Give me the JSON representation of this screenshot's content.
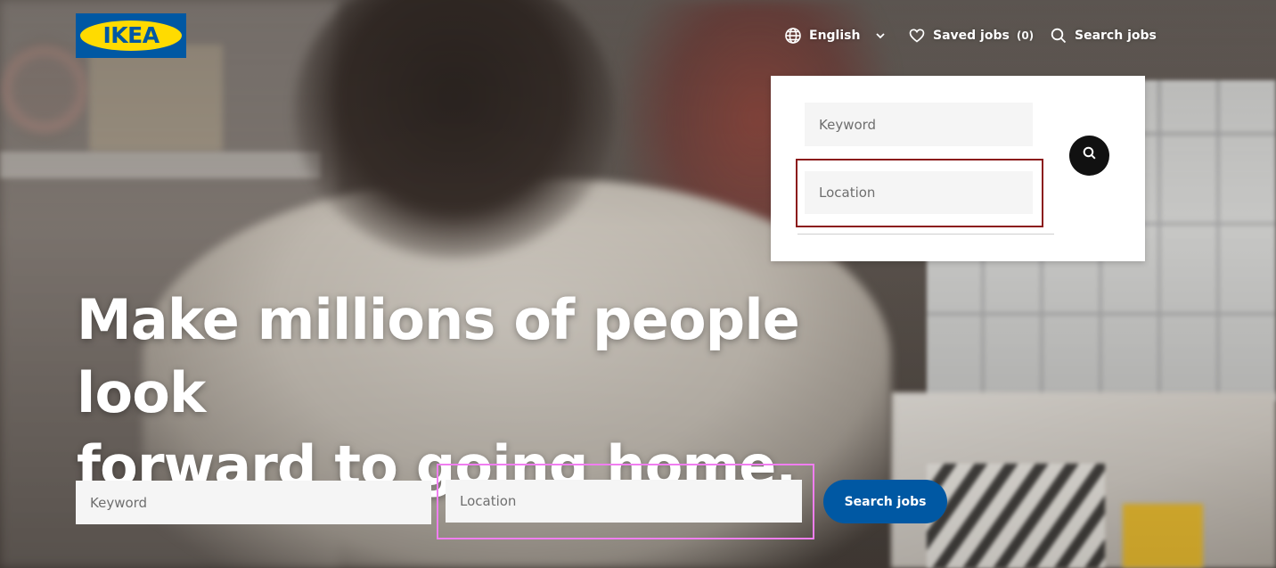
{
  "brand": {
    "logo_text": "IKEA",
    "colors": {
      "blue": "#0058a3",
      "yellow": "#ffdb00"
    }
  },
  "header": {
    "language": {
      "label": "English",
      "icon": "globe-icon",
      "dropdown_icon": "chevron-down-icon"
    },
    "saved_jobs": {
      "label": "Saved jobs",
      "count": "(0)",
      "icon": "heart-icon"
    },
    "search_jobs": {
      "label": "Search jobs",
      "icon": "search-icon"
    }
  },
  "search_panel": {
    "keyword_placeholder": "Keyword",
    "location_placeholder": "Location",
    "submit_icon": "search-icon"
  },
  "hero": {
    "headline_line1": "Make millions of people look",
    "headline_line2": "forward to going home.",
    "keyword_placeholder": "Keyword",
    "location_placeholder": "Location",
    "search_button_label": "Search jobs",
    "button_color": "#0058a3"
  }
}
